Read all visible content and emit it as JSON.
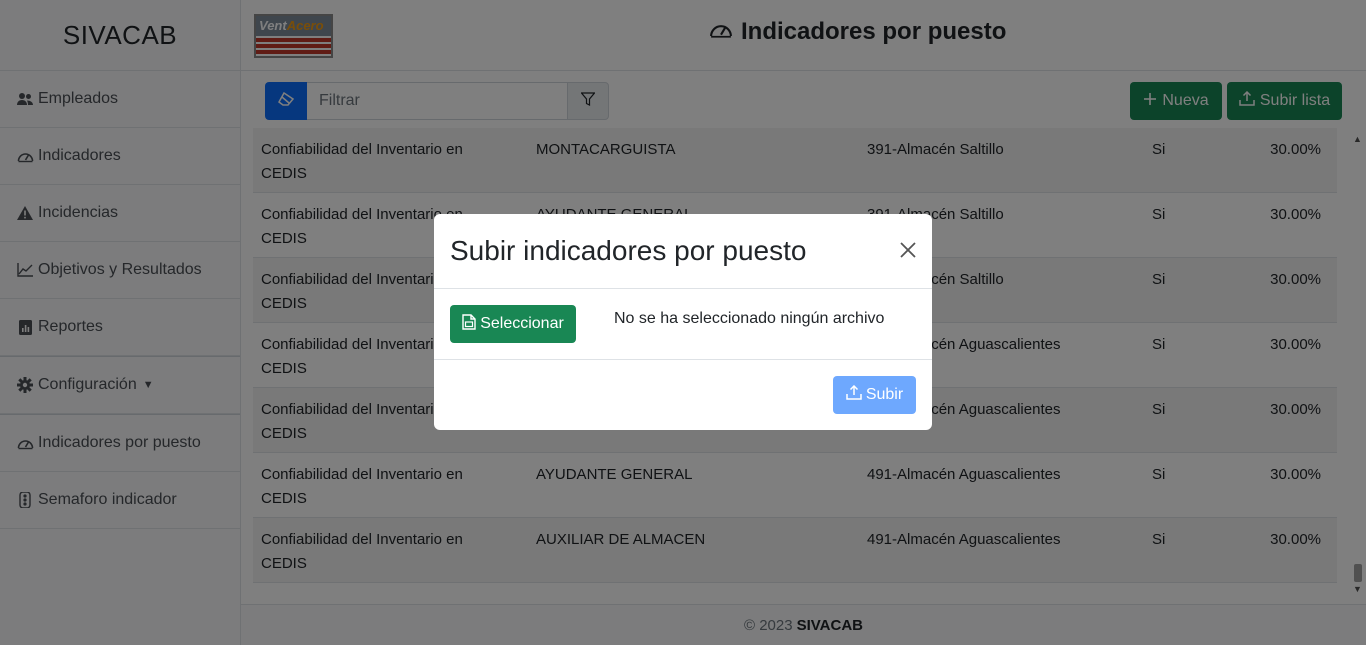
{
  "app": {
    "brand": "SIVACAB"
  },
  "header": {
    "logo_text_a": "Vent",
    "logo_text_b": "Acero",
    "title": "Indicadores por puesto"
  },
  "sidebar": {
    "items": [
      {
        "label": "Empleados",
        "icon": "users-icon"
      },
      {
        "label": "Indicadores",
        "icon": "speedometer-icon"
      },
      {
        "label": "Incidencias",
        "icon": "warning-icon"
      },
      {
        "label": "Objetivos y Resultados",
        "icon": "line-chart-icon"
      },
      {
        "label": "Reportes",
        "icon": "report-icon"
      },
      {
        "label": "Configuración",
        "icon": "gear-icon"
      },
      {
        "label": "Indicadores por puesto",
        "icon": "speedometer-icon"
      },
      {
        "label": "Semaforo indicador",
        "icon": "traffic-light-icon"
      }
    ]
  },
  "toolbar": {
    "filter_placeholder": "Filtrar",
    "new_label": "Nueva",
    "upload_list_label": "Subir lista"
  },
  "table": {
    "rows": [
      [
        "Confiabilidad del Inventario en CEDIS",
        "MONTACARGUISTA",
        "391-Almacén Saltillo",
        "Si",
        "30.00%"
      ],
      [
        "Confiabilidad del Inventario en CEDIS",
        "AYUDANTE GENERAL",
        "391-Almacén Saltillo",
        "Si",
        "30.00%"
      ],
      [
        "Confiabilidad del Inventario en CEDIS",
        "",
        "391-Almacén Saltillo",
        "Si",
        "30.00%"
      ],
      [
        "Confiabilidad del Inventario en CEDIS",
        "",
        "491-Almacén Aguascalientes",
        "Si",
        "30.00%"
      ],
      [
        "Confiabilidad del Inventario en CEDIS",
        "",
        "491-Almacén Aguascalientes",
        "Si",
        "30.00%"
      ],
      [
        "Confiabilidad del Inventario en CEDIS",
        "AYUDANTE GENERAL",
        "491-Almacén Aguascalientes",
        "Si",
        "30.00%"
      ],
      [
        "Confiabilidad del Inventario en CEDIS",
        "AUXILIAR DE ALMACEN",
        "491-Almacén Aguascalientes",
        "Si",
        "30.00%"
      ]
    ]
  },
  "footer": {
    "copyright": "© 2023",
    "brand": "SIVACAB"
  },
  "modal": {
    "title": "Subir indicadores por puesto",
    "select_label": "Seleccionar",
    "file_status": "No se ha seleccionado ningún archivo",
    "submit_label": "Subir"
  },
  "colors": {
    "primary": "#0d6efd",
    "success": "#198754",
    "submit_disabled": "#6ea8fe"
  }
}
